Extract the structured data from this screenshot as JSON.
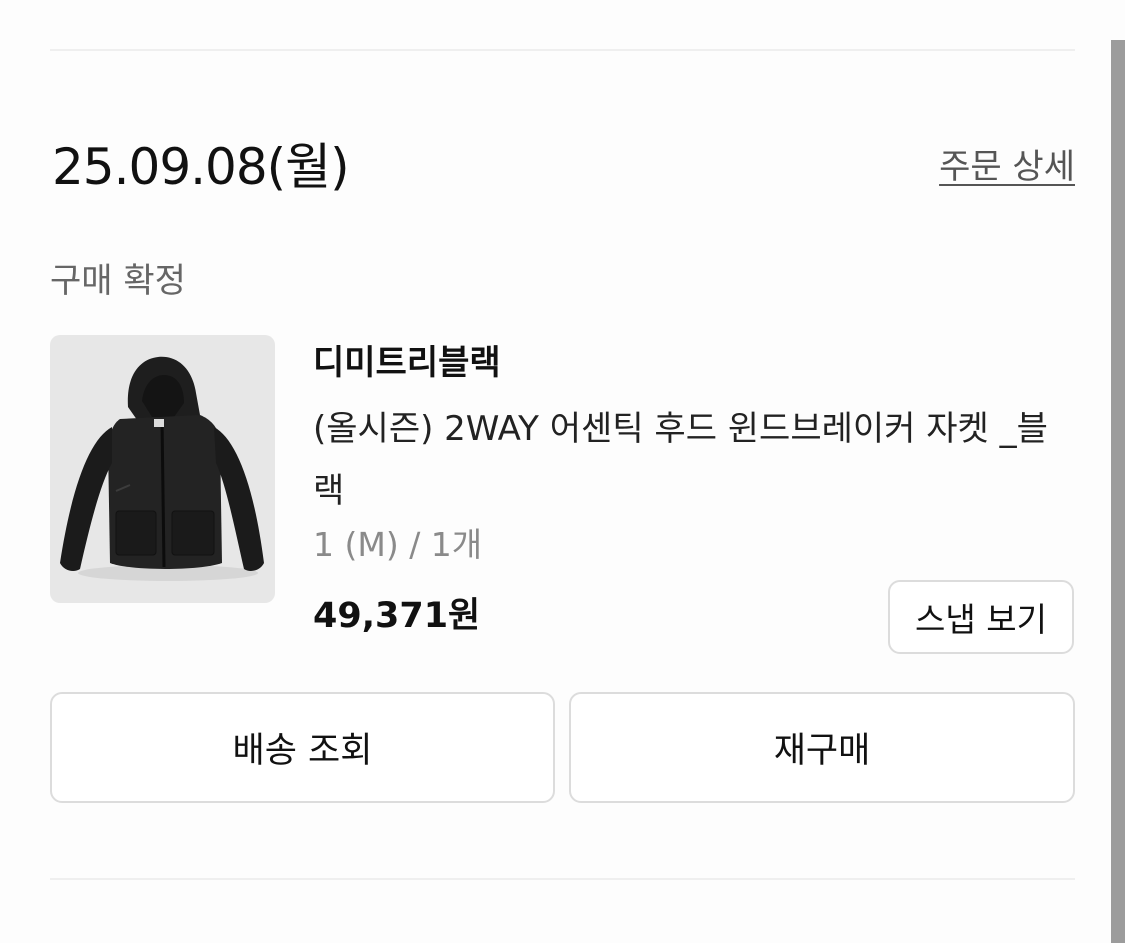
{
  "order": {
    "date": "25.09.08(월)",
    "detail_link": "주문 상세",
    "status": "구매 확정"
  },
  "product": {
    "image_icon": "jacket-image",
    "brand": "디미트리블랙",
    "name": "(올시즌) 2WAY 어센틱 후드 윈드브레이커 자켓 _블랙",
    "option": "1 (M) / 1개",
    "price": "49,371원",
    "snap_button": "스냅 보기"
  },
  "actions": {
    "track_delivery": "배송 조회",
    "rebuy": "재구매"
  }
}
